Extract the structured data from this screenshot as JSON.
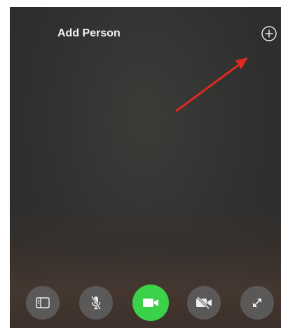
{
  "header": {
    "title": "Add Person",
    "add_icon": "plus-circle-icon"
  },
  "controls": [
    {
      "name": "sidebar-toggle",
      "icon": "sidebar-icon"
    },
    {
      "name": "mute",
      "icon": "mic-muted-icon"
    },
    {
      "name": "camera",
      "icon": "video-camera-icon",
      "active": true
    },
    {
      "name": "camera-off",
      "icon": "video-off-icon"
    },
    {
      "name": "fullscreen",
      "icon": "expand-icon"
    }
  ],
  "colors": {
    "background": "#2f2f2e",
    "active": "#3bd24a",
    "annotation_arrow": "#e0281e",
    "text": "#f2f2f2"
  }
}
